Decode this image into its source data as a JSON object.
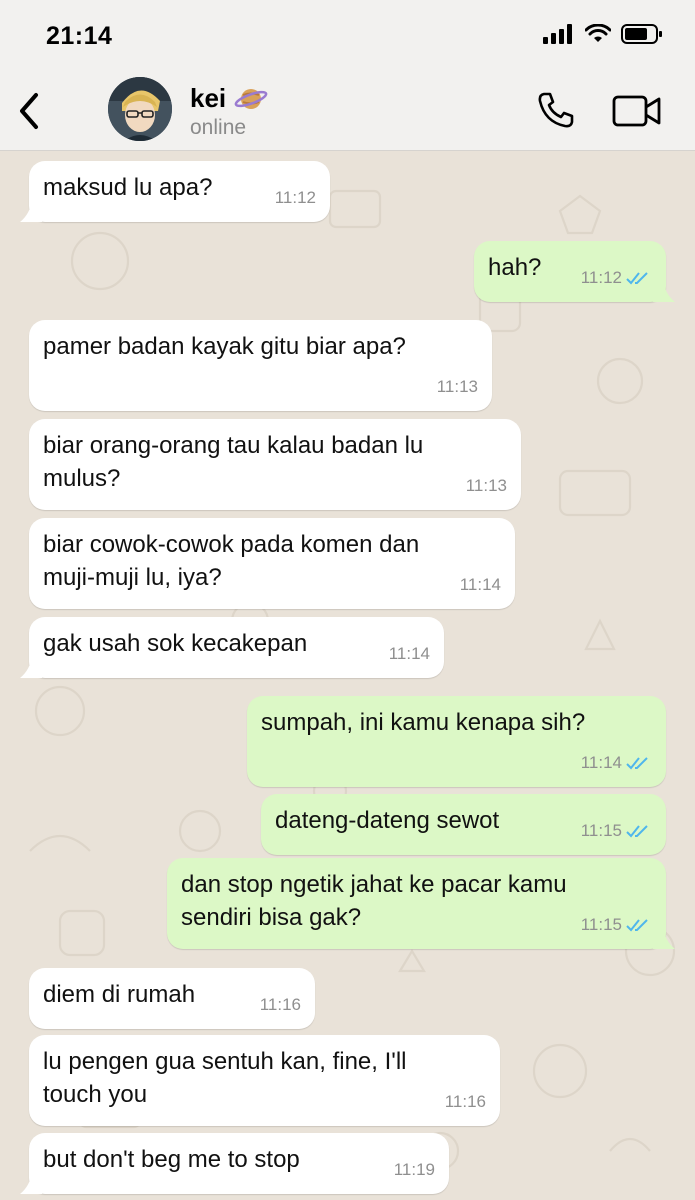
{
  "status_bar": {
    "time": "21:14"
  },
  "header": {
    "contact_name": "kei",
    "contact_emoji": "planet-emoji",
    "contact_status": "online"
  },
  "colors": {
    "incoming_bubble": "#ffffff",
    "outgoing_bubble": "#dcf8c6",
    "read_ticks": "#4fb6ec",
    "timestamp": "#8f8f8f",
    "wallpaper": "#e9e2d8"
  },
  "messages": [
    {
      "direction": "in",
      "text": "maksud lu apa?",
      "time": "11:12"
    },
    {
      "direction": "out",
      "text": "hah?",
      "time": "11:12",
      "read": true
    },
    {
      "direction": "in",
      "text": "pamer badan kayak gitu biar apa?",
      "time": "11:13"
    },
    {
      "direction": "in",
      "text": "biar orang-orang tau kalau badan lu\nmulus?",
      "time": "11:13"
    },
    {
      "direction": "in",
      "text": "biar cowok-cowok pada komen dan\nmuji-muji lu, iya?",
      "time": "11:14"
    },
    {
      "direction": "in",
      "text": "gak usah sok kecakepan",
      "time": "11:14"
    },
    {
      "direction": "out",
      "text": "sumpah, ini kamu kenapa sih?",
      "time": "11:14",
      "read": true
    },
    {
      "direction": "out",
      "text": "dateng-dateng sewot",
      "time": "11:15",
      "read": true
    },
    {
      "direction": "out",
      "text": "dan stop ngetik jahat ke pacar kamu\nsendiri bisa gak?",
      "time": "11:15",
      "read": true
    },
    {
      "direction": "in",
      "text": "diem di rumah",
      "time": "11:16"
    },
    {
      "direction": "in",
      "text": "lu pengen gua sentuh kan, fine, I'll\ntouch you",
      "time": "11:16"
    },
    {
      "direction": "in",
      "text": "but don't beg me to stop",
      "time": "11:19"
    }
  ]
}
